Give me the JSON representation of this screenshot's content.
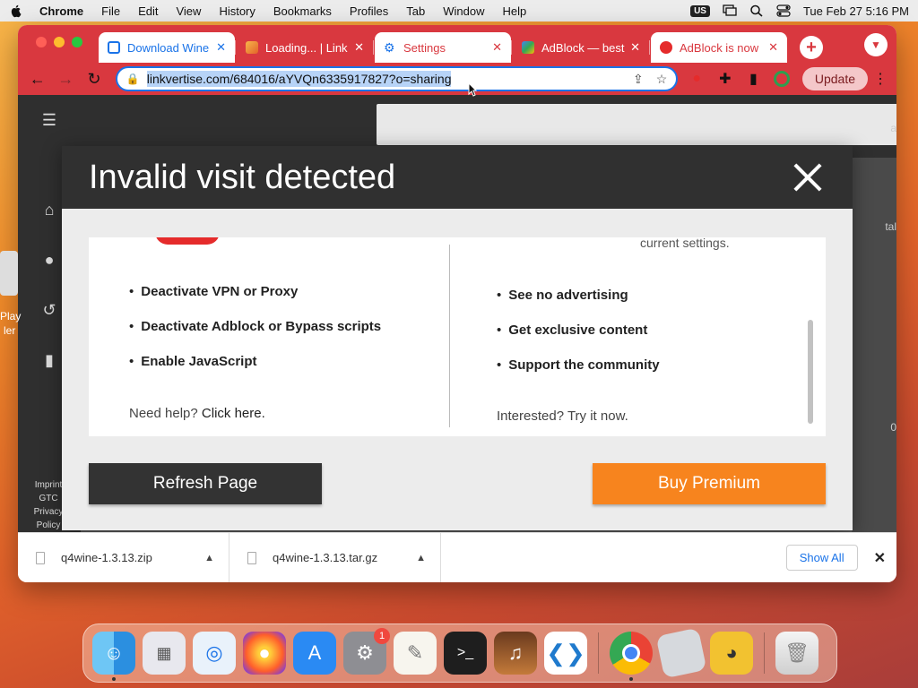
{
  "menubar": {
    "app_name": "Chrome",
    "items": [
      "File",
      "Edit",
      "View",
      "History",
      "Bookmarks",
      "Profiles",
      "Tab",
      "Window",
      "Help"
    ],
    "input_source": "US",
    "datetime": "Tue Feb 27  5:16 PM"
  },
  "tabs": [
    {
      "title": "Download Wine",
      "active": true
    },
    {
      "title": "Loading... | Link",
      "active": false
    },
    {
      "title": "Settings",
      "active": false
    },
    {
      "title": "AdBlock — best",
      "active": false
    },
    {
      "title": "AdBlock is now",
      "active": false
    }
  ],
  "toolbar": {
    "url": "linkvertise.com/684016/aYVQn6335917827?o=sharing",
    "update_label": "Update"
  },
  "site": {
    "footer_links": [
      "Imprint",
      "GTC",
      "Privacy",
      "Policy"
    ],
    "side_fragments": {
      "left_1": "Play",
      "left_2": "ler",
      "right_1": "a",
      "right_2": "tal",
      "right_3": "0"
    }
  },
  "modal": {
    "title": "Invalid visit detected",
    "left_cut_text": "",
    "right_cut_text": "current settings.",
    "left_bullets": [
      "Deactivate VPN or Proxy",
      "Deactivate Adblock or Bypass scripts",
      "Enable JavaScript"
    ],
    "help_prefix": "Need help? ",
    "help_link": "Click here.",
    "right_bullets": [
      "See no advertising",
      "Get exclusive content",
      "Support the community"
    ],
    "interest_text": "Interested? Try it now.",
    "refresh_label": "Refresh Page",
    "premium_label": "Buy Premium"
  },
  "downloads": {
    "items": [
      {
        "name": "q4wine-1.3.13.zip"
      },
      {
        "name": "q4wine-1.3.13.tar.gz"
      }
    ],
    "show_all_label": "Show All"
  },
  "dock": {
    "system_settings_badge": "1"
  }
}
